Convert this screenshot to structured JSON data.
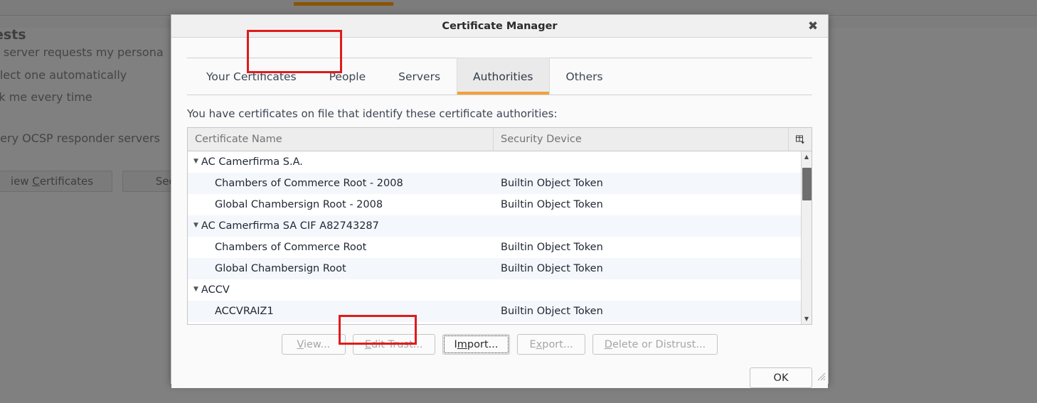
{
  "background": {
    "heading": "ests",
    "lines": [
      "a server requests my persona",
      "elect one automatically",
      "sk me every time",
      "uery OCSP responder servers"
    ],
    "buttons": [
      {
        "label": "iew Certificates",
        "mnemonic": "C"
      },
      {
        "label": "Secu",
        "mnemonic": ""
      }
    ]
  },
  "dialog": {
    "title": "Certificate Manager",
    "close_icon": "✖",
    "tabs": [
      {
        "label": "Your Certificates",
        "selected": false
      },
      {
        "label": "People",
        "selected": false
      },
      {
        "label": "Servers",
        "selected": false
      },
      {
        "label": "Authorities",
        "selected": true
      },
      {
        "label": "Others",
        "selected": false
      }
    ],
    "description": "You have certificates on file that identify these certificate authorities:",
    "table": {
      "columns": [
        "Certificate Name",
        "Security Device"
      ],
      "picker_icon": "column-picker",
      "rows": [
        {
          "type": "group",
          "name": "AC Camerfirma S.A.",
          "device": "",
          "stripe": false
        },
        {
          "type": "cert",
          "name": "Chambers of Commerce Root - 2008",
          "device": "Builtin Object Token",
          "stripe": true
        },
        {
          "type": "cert",
          "name": "Global Chambersign Root - 2008",
          "device": "Builtin Object Token",
          "stripe": false
        },
        {
          "type": "group",
          "name": "AC Camerfirma SA CIF A82743287",
          "device": "",
          "stripe": true
        },
        {
          "type": "cert",
          "name": "Chambers of Commerce Root",
          "device": "Builtin Object Token",
          "stripe": false
        },
        {
          "type": "cert",
          "name": "Global Chambersign Root",
          "device": "Builtin Object Token",
          "stripe": true
        },
        {
          "type": "group",
          "name": "ACCV",
          "device": "",
          "stripe": false
        },
        {
          "type": "cert",
          "name": "ACCVRAIZ1",
          "device": "Builtin Object Token",
          "stripe": true
        }
      ],
      "scroll_up_icon": "▲",
      "scroll_down_icon": "▼"
    },
    "actions": [
      {
        "label": "View...",
        "mnemonic": "V",
        "rest": "iew...",
        "disabled": true,
        "focused": false
      },
      {
        "label": "Edit Trust...",
        "mnemonic": "E",
        "rest": "dit Trust...",
        "disabled": true,
        "focused": false
      },
      {
        "label": "Import...",
        "mnemonic": "m",
        "pre": "I",
        "rest": "port...",
        "disabled": false,
        "focused": true
      },
      {
        "label": "Export...",
        "mnemonic": "x",
        "pre": "E",
        "rest": "port...",
        "disabled": true,
        "focused": false
      },
      {
        "label": "Delete or Distrust...",
        "mnemonic": "D",
        "rest": "elete or Distrust...",
        "disabled": true,
        "focused": false
      }
    ],
    "ok_label": "OK"
  },
  "highlights": {
    "tab_color": "#e01b1b",
    "import_color": "#e01b1b",
    "accent_orange": "#f2a13b"
  }
}
